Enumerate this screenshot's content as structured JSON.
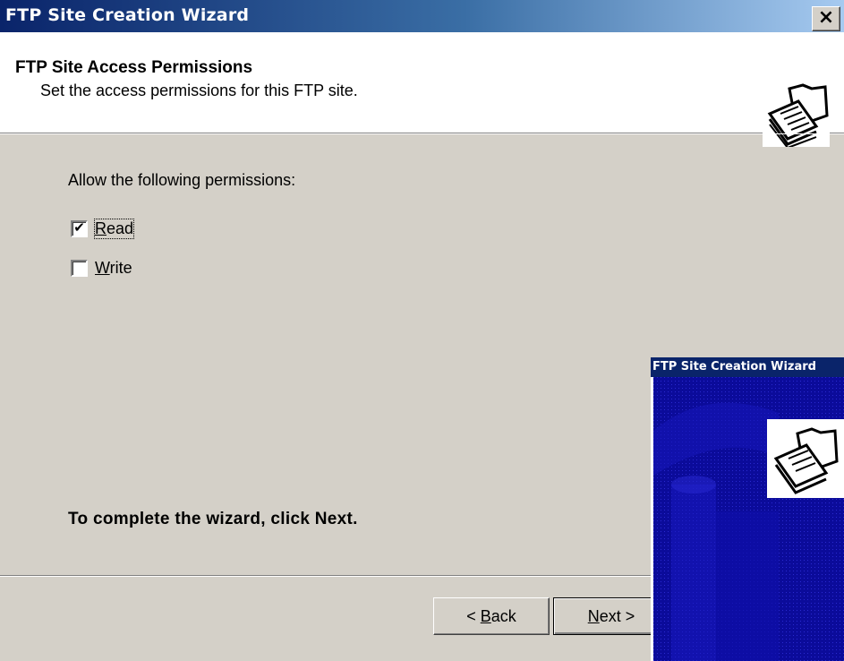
{
  "window": {
    "title": "FTP Site Creation Wizard",
    "close_label": "×"
  },
  "header": {
    "title": "FTP Site Access Permissions",
    "subtitle": "Set the access permissions for this FTP site.",
    "icon": "ftp-folder-wizard-icon"
  },
  "permissions": {
    "label": "Allow the following permissions:",
    "read": {
      "first": "R",
      "rest": "ead",
      "checked": true,
      "mark": "✔"
    },
    "write": {
      "first": "W",
      "rest": "rite",
      "checked": false,
      "mark": ""
    }
  },
  "footer_note": "To complete the wizard, click Next.",
  "buttons": {
    "back": {
      "prefix": "< ",
      "accel": "B",
      "rest": "ack"
    },
    "next": {
      "accel": "N",
      "rest": "ext >"
    }
  },
  "preview": {
    "title": "FTP Site Creation Wizard",
    "icon": "ftp-folder-wizard-icon"
  },
  "colors": {
    "titlebar_start": "#0a246a",
    "titlebar_end": "#a6caf0",
    "dialog_bg": "#d4d0c8",
    "preview_bg": "#0b0b9a"
  }
}
